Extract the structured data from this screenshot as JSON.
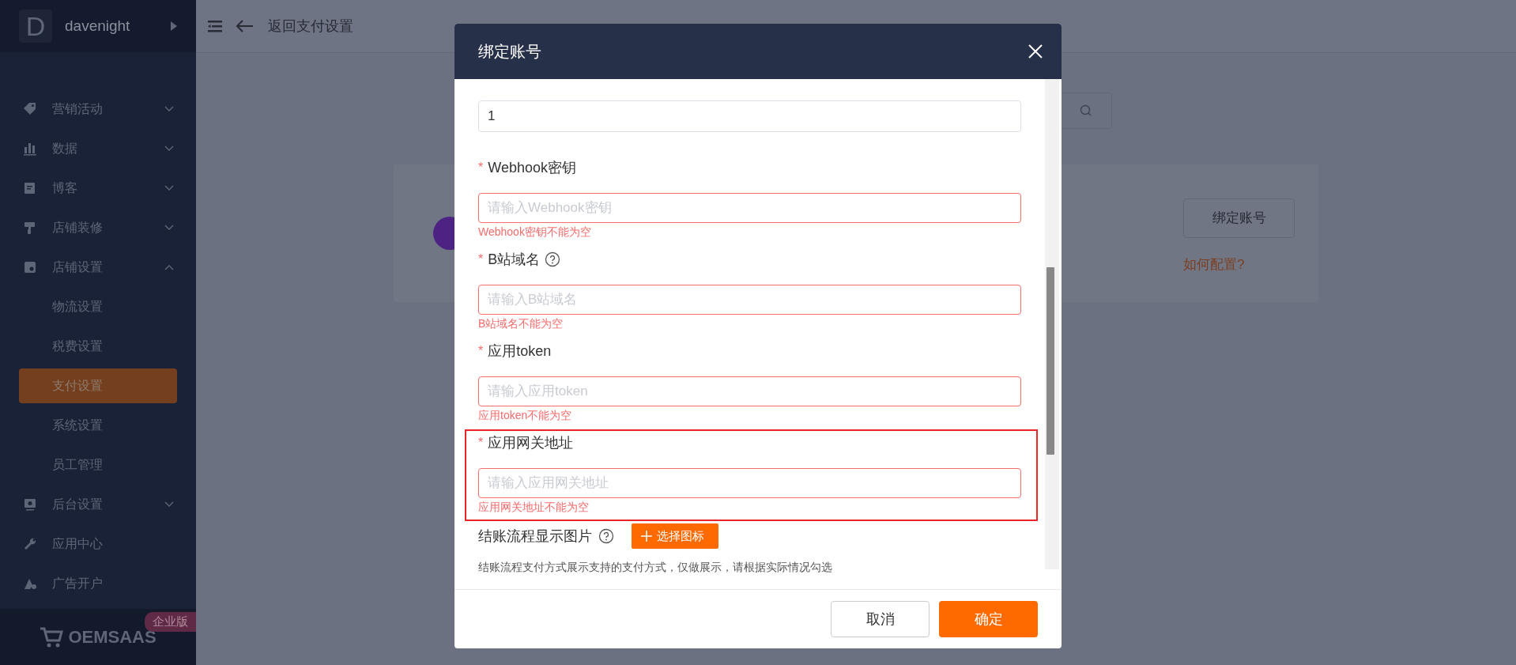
{
  "sidebar": {
    "brand": {
      "letter": "D",
      "name": "davenight"
    },
    "items": [
      {
        "kind": "group",
        "label": "营销活动",
        "expanded": false
      },
      {
        "kind": "group",
        "label": "数据",
        "expanded": false
      },
      {
        "kind": "group",
        "label": "博客",
        "expanded": false
      },
      {
        "kind": "group",
        "label": "店铺装修",
        "expanded": false
      },
      {
        "kind": "group",
        "label": "店铺设置",
        "expanded": true,
        "children": [
          {
            "label": "物流设置",
            "selected": false
          },
          {
            "label": "税费设置",
            "selected": false
          },
          {
            "label": "支付设置",
            "selected": true
          },
          {
            "label": "系统设置",
            "selected": false
          },
          {
            "label": "员工管理",
            "selected": false
          }
        ]
      },
      {
        "kind": "group",
        "label": "后台设置",
        "expanded": false
      },
      {
        "kind": "link",
        "label": "应用中心"
      },
      {
        "kind": "link",
        "label": "广告开户"
      }
    ],
    "footer": {
      "logo": "OEMSAAS",
      "badge": "企业版"
    }
  },
  "header": {
    "back_label": "返回支付设置"
  },
  "card": {
    "bind_button": "绑定账号",
    "help_link": "如何配置?"
  },
  "dialog": {
    "title": "绑定账号",
    "fields": [
      {
        "value": "1",
        "highlighted": false
      },
      {
        "label": "Webhook密钥",
        "required_mark": "*",
        "help": false,
        "placeholder": "请输入Webhook密钥",
        "error": "Webhook密钥不能为空",
        "highlighted": false
      },
      {
        "label": "B站域名",
        "required_mark": "*",
        "help": true,
        "placeholder": "请输入B站域名",
        "error": "B站域名不能为空",
        "highlighted": false
      },
      {
        "label": "应用token",
        "required_mark": "*",
        "help": false,
        "placeholder": "请输入应用token",
        "error": "应用token不能为空",
        "highlighted": false
      },
      {
        "label": "应用网关地址",
        "required_mark": "*",
        "help": false,
        "placeholder": "请输入应用网关地址",
        "error": "应用网关地址不能为空",
        "highlighted": true
      }
    ],
    "image_field": {
      "label": "结账流程显示图片",
      "help": true,
      "button": "选择图标",
      "note": "结账流程支付方式展示支持的支付方式，仅做展示，请根据实际情况勾选"
    },
    "buttons": [
      {
        "kind": "secondary",
        "label": "取消"
      },
      {
        "kind": "primary",
        "label": "确定"
      }
    ]
  }
}
